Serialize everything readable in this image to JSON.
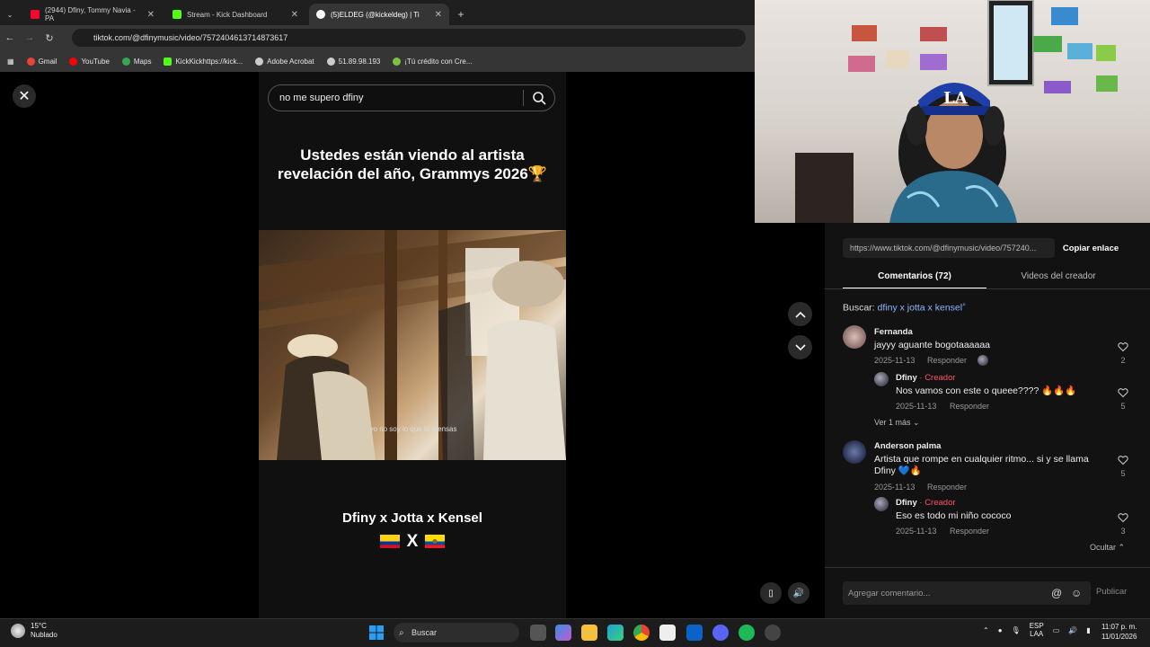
{
  "browser": {
    "tabs": [
      {
        "label": "(2944) Dfiny, Tommy Navia - PA",
        "color": "#ff0033"
      },
      {
        "label": "Stream - Kick Dashboard",
        "color": "#53fc18"
      },
      {
        "label": "(5)ELDEG (@kickeldeg) | Ti",
        "color": "#ffffff"
      }
    ],
    "new_tab": "+",
    "url": "tiktok.com/@dfinymusic/video/7572404613714873617",
    "bookmarks": [
      "Gmail",
      "YouTube",
      "Maps",
      "KickKickhttps://kick...",
      "Adobe Acrobat",
      "51.89.98.193",
      "¡Tú crédito con Cre..."
    ]
  },
  "video": {
    "search_value": "no me supero dfiny",
    "caption": "Ustedes están viendo al artista revelación del año, Grammys 2026🏆",
    "subtitle": "yo no soy lo que tú piensas",
    "song_title": "Dfiny x Jotta x Kensel",
    "flags_separator": "X"
  },
  "side": {
    "link": "https://www.tiktok.com/@dfinymusic/video/757240...",
    "copy_label": "Copiar enlace",
    "tab_comments": "Comentarios (72)",
    "tab_videos": "Videos del creador",
    "search_prefix": "Buscar:",
    "search_query": "dfiny x jotta x kensel",
    "comments": [
      {
        "user": "Fernanda",
        "text": "jayyy aguante bogotaaaaaa",
        "date": "2025-11-13",
        "reply": "Responder",
        "likes": "2"
      },
      {
        "user": "Dfiny",
        "badge": "· Creador",
        "text": "Nos vamos con este o queee???? 🔥🔥🔥",
        "date": "2025-11-13",
        "reply": "Responder",
        "likes": "5"
      },
      {
        "user": "Anderson palma",
        "text": "Artista que rompe en cualquier ritmo... si y se llama Dfiny 💙🔥",
        "date": "2025-11-13",
        "reply": "Responder",
        "likes": "5"
      },
      {
        "user": "Dfiny",
        "badge": "· Creador",
        "text": "Eso es todo mi niño cococo",
        "date": "2025-11-13",
        "reply": "Responder",
        "likes": "3"
      }
    ],
    "see_more": "Ver 1 más ⌄",
    "hide": "Ocultar ⌃",
    "comment_placeholder": "Agregar comentario...",
    "mention": "@",
    "publish": "Publicar"
  },
  "taskbar": {
    "temp": "15°C",
    "weather": "Nublado",
    "search": "Buscar",
    "lang1": "ESP",
    "lang2": "LAA",
    "time": "11:07 p. m.",
    "date": "11/01/2026"
  }
}
